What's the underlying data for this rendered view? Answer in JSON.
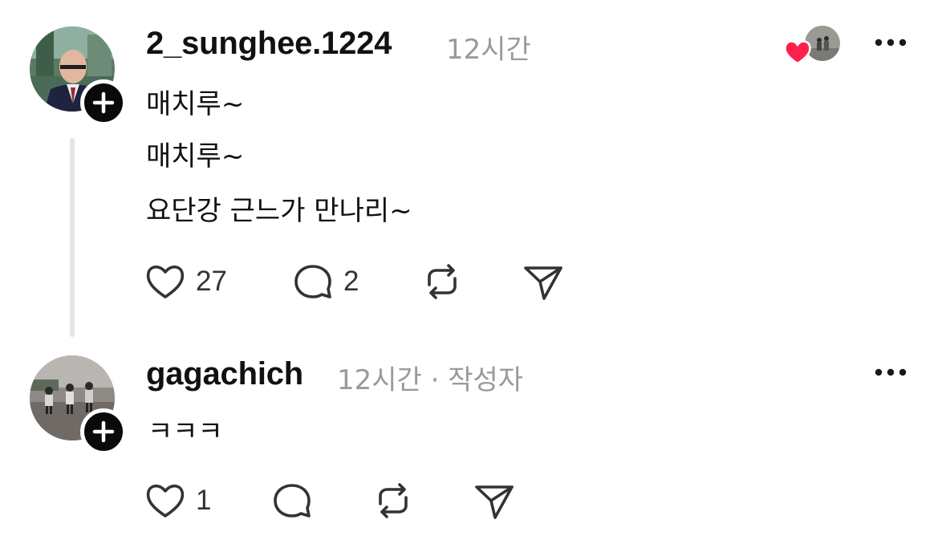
{
  "colors": {
    "text": "#111111",
    "muted": "#9a9a9a",
    "icon": "#333333",
    "like_heart": "#ff1f4b",
    "thread_line": "#e4e4e4"
  },
  "reply": {
    "username": "2_sunghee.1224",
    "time": "12시간",
    "lines": [
      "매치루~",
      "매치루~",
      "요단강 근느가 만나리~"
    ],
    "like_count": "27",
    "comment_count": "2",
    "liked_by_author_icon": "heart-icon"
  },
  "author_reply": {
    "username": "gagachich",
    "meta": "12시간 · 작성자",
    "text": "ㅋㅋㅋ",
    "like_count": "1"
  },
  "icons": {
    "like": "heart-outline-icon",
    "comment": "speech-bubble-icon",
    "repost": "repost-icon",
    "share": "paper-plane-icon",
    "more": "more-dots-icon",
    "follow": "plus-icon"
  }
}
